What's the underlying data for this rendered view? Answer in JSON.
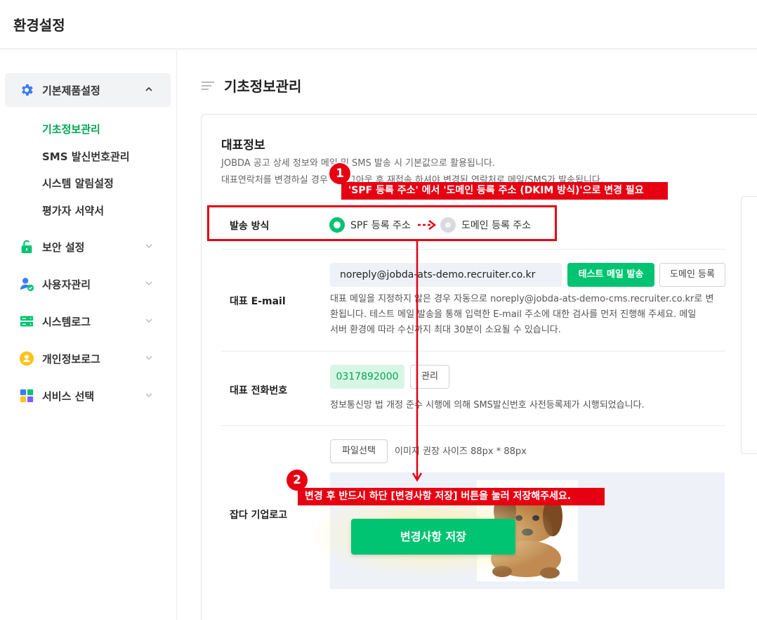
{
  "header": {
    "title": "환경설정"
  },
  "sidebar": {
    "groups": [
      {
        "label": "기본제품설정",
        "icon": "gear-icon"
      },
      {
        "label": "보안 설정",
        "icon": "lock-icon"
      },
      {
        "label": "사용자관리",
        "icon": "user-check-icon"
      },
      {
        "label": "시스템로그",
        "icon": "server-icon"
      },
      {
        "label": "개인정보로그",
        "icon": "user-circle-icon"
      },
      {
        "label": "서비스 선택",
        "icon": "apps-grid-icon"
      }
    ],
    "sub_items": [
      "기초정보관리",
      "SMS 발신번호관리",
      "시스템 알림설정",
      "평가자 서약서"
    ],
    "active_sub": "기초정보관리"
  },
  "main": {
    "page_title": "기초정보관리",
    "card": {
      "title": "대표정보",
      "desc1": "JOBDA 공고 상세 정보와 메일 및 SMS 발송 시 기본값으로 활용됩니다.",
      "desc2": "대표연락처를 변경하실 경우 재로그아웃 후 재접속 하셔야 변경된 연락처로 메일/SMS가 발송됩니다."
    },
    "send_method": {
      "label": "발송 방식",
      "option_spf": "SPF 등록 주소",
      "option_domain": "도메인 등록 주소",
      "selected": "SPF 등록 주소"
    },
    "email": {
      "label": "대표 E-mail",
      "value": "noreply@jobda-ats-demo.recruiter.co.kr",
      "test_button": "테스트 메일 발송",
      "domain_button": "도메인 등록",
      "help_1": "대표 메일을 지정하지 않은 경우 자동으로 noreply@jobda-ats-demo-cms.recruiter.co.kr로 변",
      "help_2": "환됩니다. 테스트 메일 발송을 통해 입력한 E-mail 주소에 대한 검사를 먼저 진행해 주세요. 메일",
      "help_3": "서버 환경에 따라 수신까지 최대 30분이 소요될 수 있습니다."
    },
    "phone": {
      "label": "대표 전화번호",
      "value": "0317892000",
      "manage_button": "관리",
      "help": "정보통신망 법 개정 준수 시행에 의해 SMS발신번호 사전등록제가 시행되었습니다."
    },
    "logo": {
      "label": "잡다 기업로고",
      "file_button": "파일선택",
      "size_hint": "이미지 권장 사이즈 88px * 88px"
    },
    "save_button": "변경사항 저장"
  },
  "annotations": {
    "badge_1": "1",
    "banner_1": "'SPF 등록 주소' 에서 '도메인 등록 주소 (DKIM 방식)'으로 변경 필요",
    "badge_2": "2",
    "banner_2": "변경 후 반드시 하단 [변경사항 저장] 버튼을 눌러 저장해주세요.",
    "color": "#e60012"
  },
  "colors": {
    "accent_green": "#00c471",
    "active_text": "#00a651"
  }
}
